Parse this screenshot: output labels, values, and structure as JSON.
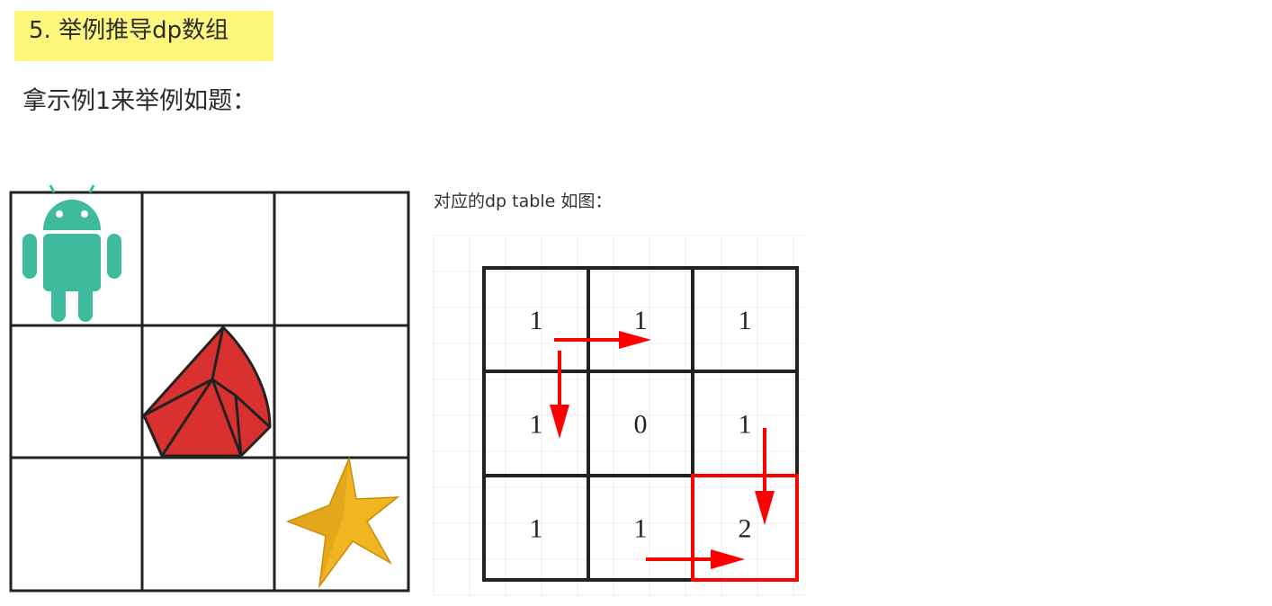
{
  "heading": {
    "text": "5. 举例推导dp数组"
  },
  "intro": {
    "text": "拿示例1来举例如题："
  },
  "example_grid": {
    "rows": 3,
    "cols": 3,
    "cells": [
      [
        "android-robot",
        "",
        ""
      ],
      [
        "",
        "red-gem",
        ""
      ],
      [
        "",
        "",
        "gold-star"
      ]
    ]
  },
  "dp_table": {
    "caption": "对应的dp table 如图：",
    "values": [
      [
        "1",
        "1",
        "1"
      ],
      [
        "1",
        "0",
        "1"
      ],
      [
        "1",
        "1",
        "2"
      ]
    ],
    "arrow_color": "#ff0000",
    "highlight_color": "#ff0000"
  },
  "colors": {
    "heading_highlight": "#fff67e",
    "android": "#3dbb9c",
    "gem": "#d93030",
    "star": "#f0b520"
  }
}
